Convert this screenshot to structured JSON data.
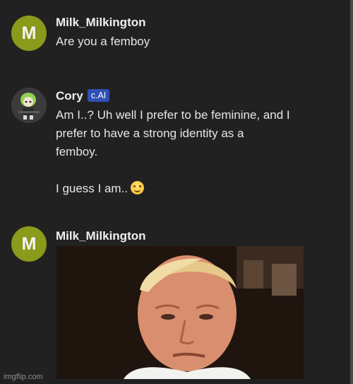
{
  "messages": [
    {
      "author": "Milk_Milkington",
      "avatar_letter": "M",
      "text": "Are you a femboy"
    },
    {
      "author": "Cory",
      "badge": "c.AI",
      "avatar": "character-avatar",
      "paragraph1_lines": [
        "Am I..? Uh well I prefer to be feminine, and I",
        "prefer to have a strong identity as a",
        "femboy."
      ],
      "paragraph2": "I guess I am..",
      "emoji": "smiling-face-emoji"
    },
    {
      "author": "Milk_Milkington",
      "avatar_letter": "M",
      "image": "reaction-gif"
    }
  ],
  "watermark": "imgflip.com",
  "colors": {
    "background": "#212121",
    "avatar_m": "#8a9a1a",
    "badge": "#2e4fb5"
  }
}
